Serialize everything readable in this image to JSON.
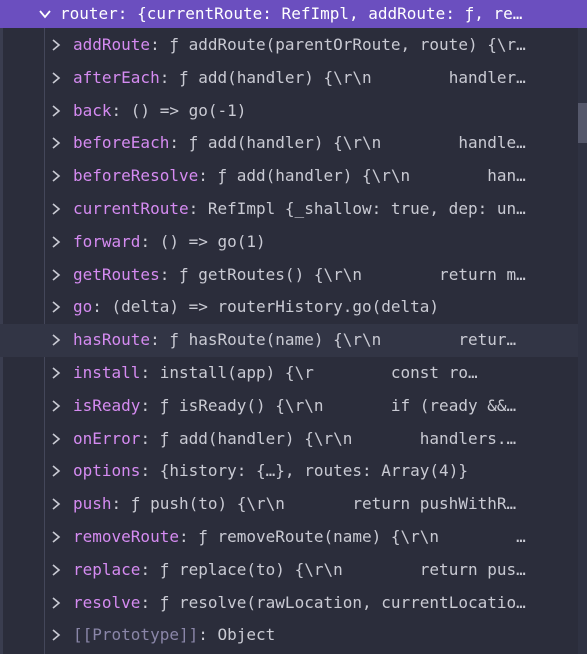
{
  "header": {
    "text": "router: {currentRoute: RefImpl, addRoute: ƒ, re…"
  },
  "rows": [
    {
      "key": "addRoute",
      "value": "ƒ addRoute(parentOrRoute, route) {\\r…"
    },
    {
      "key": "afterEach",
      "value": "ƒ add(handler) {\\r\\n        handler…"
    },
    {
      "key": "back",
      "value": "() => go(-1)"
    },
    {
      "key": "beforeEach",
      "value": "ƒ add(handler) {\\r\\n        handle…"
    },
    {
      "key": "beforeResolve",
      "value": "ƒ add(handler) {\\r\\n        han…"
    },
    {
      "key": "currentRoute",
      "value": "RefImpl {_shallow: true, dep: un…"
    },
    {
      "key": "forward",
      "value": "() => go(1)"
    },
    {
      "key": "getRoutes",
      "value": "ƒ getRoutes() {\\r\\n        return m…"
    },
    {
      "key": "go",
      "value": "(delta) => routerHistory.go(delta)"
    },
    {
      "key": "hasRoute",
      "value": "ƒ hasRoute(name) {\\r\\n        retur…"
    },
    {
      "key": "install",
      "value": "install(app) {\\r        const ro…"
    },
    {
      "key": "isReady",
      "value": "ƒ isReady() {\\r\\n       if (ready &&…"
    },
    {
      "key": "onError",
      "value": "ƒ add(handler) {\\r\\n       handlers.…"
    },
    {
      "key": "options",
      "value": "{history: {…}, routes: Array(4)}"
    },
    {
      "key": "push",
      "value": "ƒ push(to) {\\r\\n       return pushWithR…"
    },
    {
      "key": "removeRoute",
      "value": "ƒ removeRoute(name) {\\r\\n        …"
    },
    {
      "key": "replace",
      "value": "ƒ replace(to) {\\r\\n        return pus…"
    },
    {
      "key": "resolve",
      "value": "ƒ resolve(rawLocation, currentLocatio…"
    },
    {
      "key": "[[Prototype]]",
      "value": "Object"
    }
  ],
  "hovered_row": "hasRoute",
  "colors": {
    "header_bg": "#6b4fbf",
    "panel_bg": "#2b2d3b",
    "key": "#d58bf1",
    "prototype_key": "#8a86a8",
    "text": "#c9cad3"
  },
  "icons": {
    "expanded": "chevron-down-icon",
    "collapsed": "chevron-right-icon"
  }
}
